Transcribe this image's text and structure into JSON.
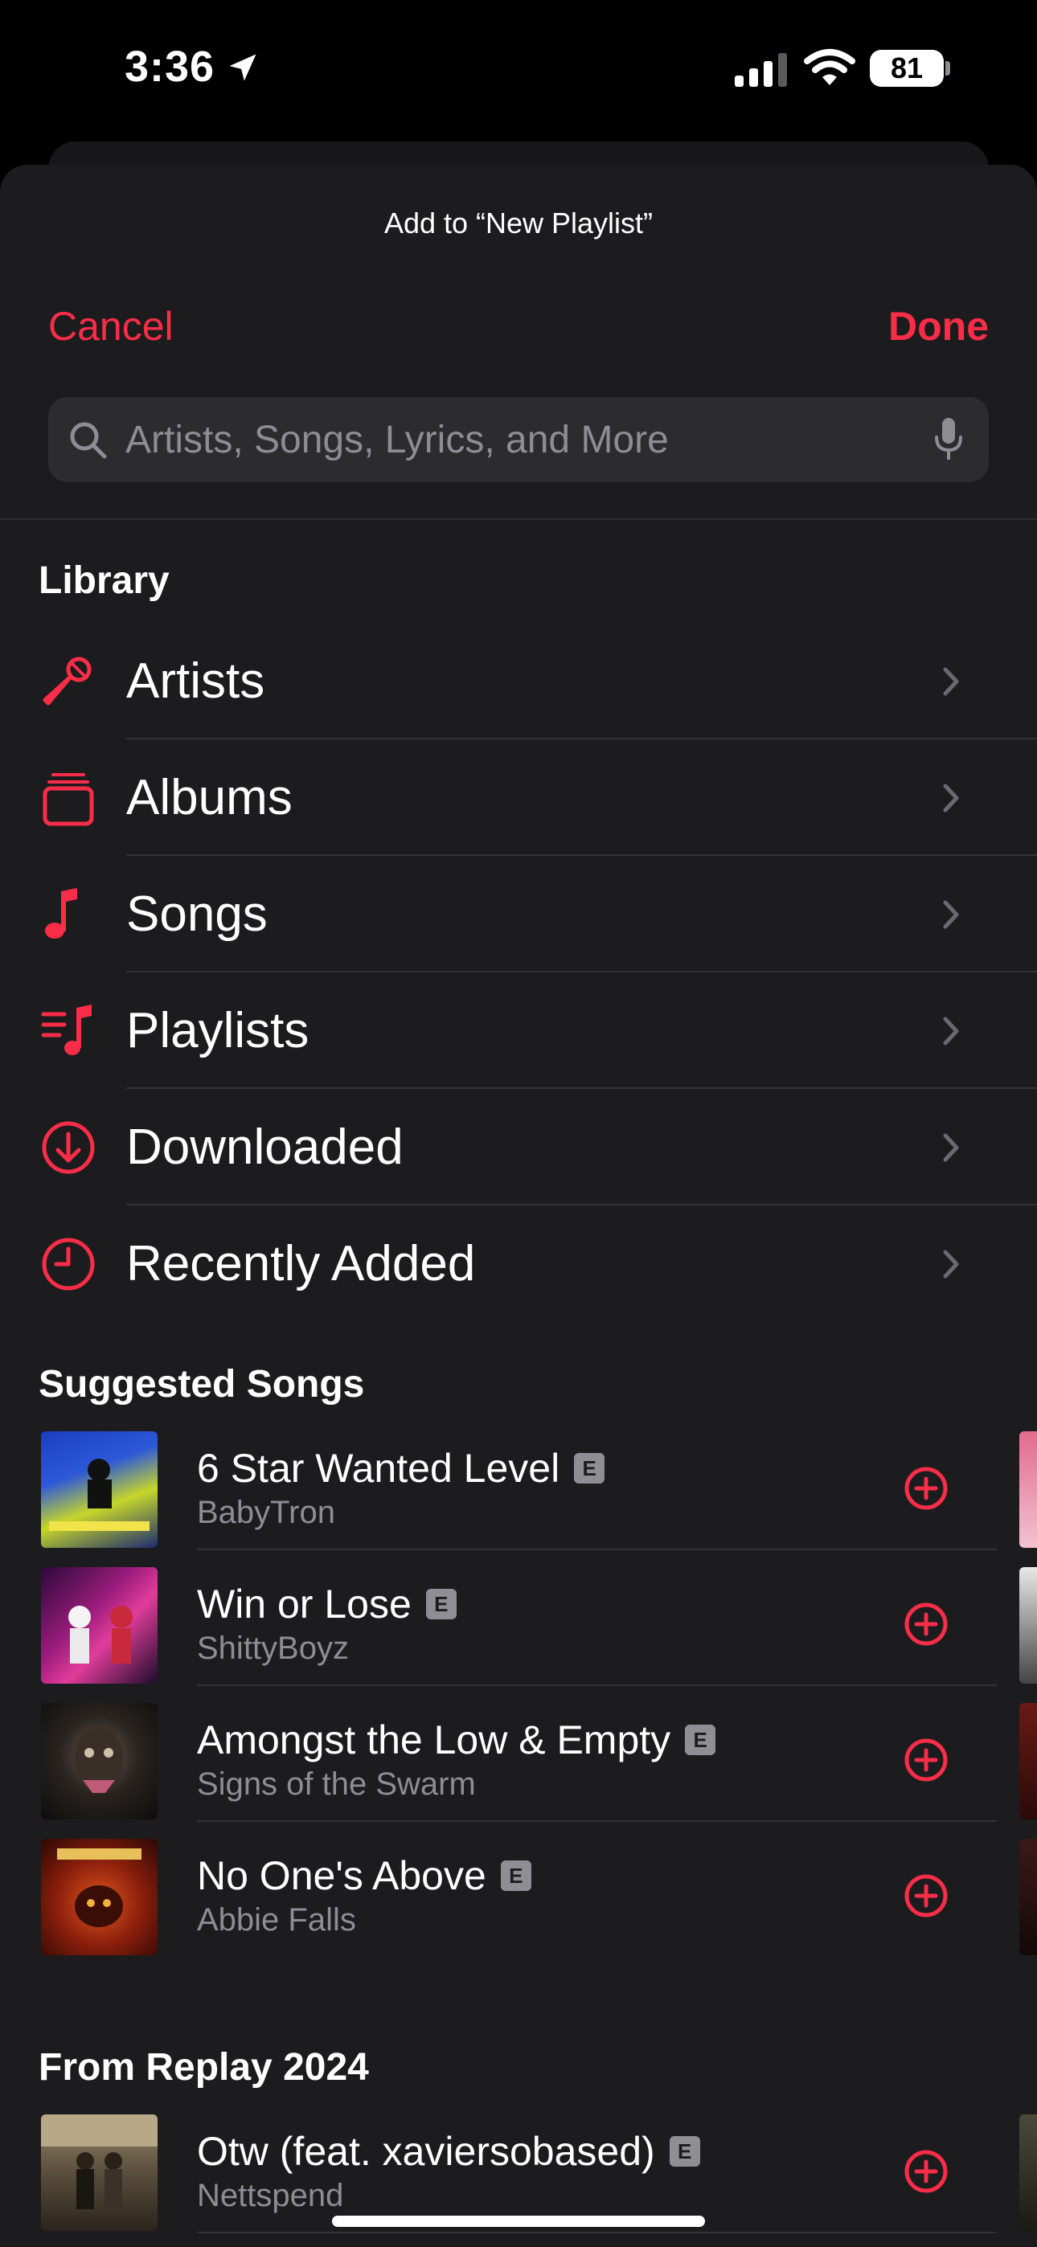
{
  "status_bar": {
    "time": "3:36",
    "battery": "81"
  },
  "sheet": {
    "title": "Add to “New Playlist”",
    "cancel_label": "Cancel",
    "done_label": "Done",
    "search_placeholder": "Artists, Songs, Lyrics, and More"
  },
  "library": {
    "header": "Library",
    "items": [
      {
        "label": "Artists",
        "icon": "microphone-icon"
      },
      {
        "label": "Albums",
        "icon": "albums-stack-icon"
      },
      {
        "label": "Songs",
        "icon": "music-note-icon"
      },
      {
        "label": "Playlists",
        "icon": "playlist-icon"
      },
      {
        "label": "Downloaded",
        "icon": "download-circle-icon"
      },
      {
        "label": "Recently Added",
        "icon": "clock-icon"
      }
    ]
  },
  "suggested": {
    "header": "Suggested Songs",
    "songs": [
      {
        "title": "6 Star Wanted Level",
        "artist": "BabyTron",
        "explicit": "E"
      },
      {
        "title": "Win or Lose",
        "artist": "ShittyBoyz",
        "explicit": "E"
      },
      {
        "title": "Amongst the Low & Empty",
        "artist": "Signs of the Swarm",
        "explicit": "E"
      },
      {
        "title": "No One's Above",
        "artist": "Abbie Falls",
        "explicit": "E"
      }
    ]
  },
  "replay": {
    "header": "From Replay 2024",
    "songs": [
      {
        "title": "Otw (feat. xaviersobased)",
        "artist": "Nettspend",
        "explicit": "E"
      }
    ]
  },
  "colors": {
    "accent": "#fa2d48",
    "background": "#1c1c1e",
    "secondary_text": "#8d8d93"
  }
}
